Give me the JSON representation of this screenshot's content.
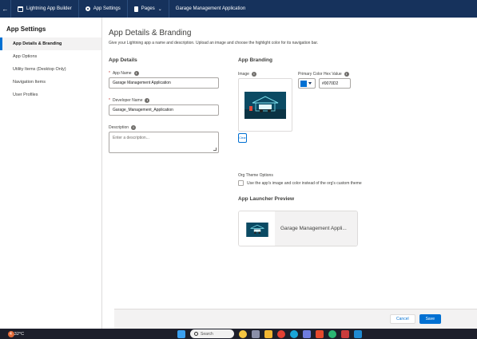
{
  "topbar": {
    "builder_label": "Lightning App Builder",
    "settings_label": "App Settings",
    "pages_label": "Pages",
    "app_name": "Garage Management Application"
  },
  "sidebar": {
    "title": "App Settings",
    "items": [
      {
        "label": "App Details & Branding",
        "active": true
      },
      {
        "label": "App Options"
      },
      {
        "label": "Utility Items (Desktop Only)"
      },
      {
        "label": "Navigation Items"
      },
      {
        "label": "User Profiles"
      }
    ]
  },
  "main": {
    "title": "App Details & Branding",
    "description": "Give your Lightning app a name and description. Upload an image and choose the highlight color for its navigation bar.",
    "details": {
      "heading": "App Details",
      "app_name_label": "App Name",
      "app_name_value": "Garage Management Application",
      "dev_name_label": "Developer Name",
      "dev_name_value": "Garage_Management_Application",
      "description_label": "Description",
      "description_placeholder": "Enter a description..."
    },
    "branding": {
      "heading": "App Branding",
      "image_label": "Image",
      "clear_label": "Clear",
      "color_label": "Primary Color Hex Value",
      "color_value": "#0070D2",
      "color_hex": "#0070d2",
      "org_theme_label": "Org Theme Options",
      "org_theme_checkbox": "Use the app's image and color instead of the org's custom theme"
    },
    "preview": {
      "heading": "App Launcher Preview",
      "name": "Garage Management Appli..."
    }
  },
  "footer": {
    "cancel_label": "Cancel",
    "save_label": "Save"
  },
  "taskbar": {
    "weather_badge": "4",
    "temperature": "32°C",
    "search_placeholder": "Search"
  }
}
